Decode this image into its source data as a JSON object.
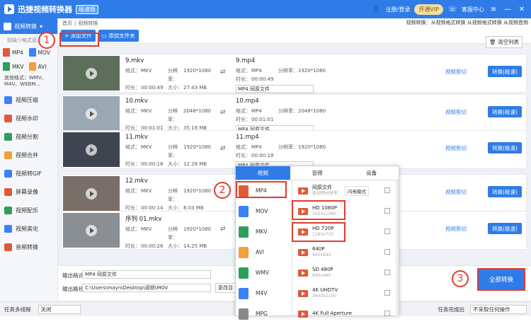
{
  "app": {
    "title": "迅捷视频转换器",
    "badge": "极速版",
    "login": "注册/登录",
    "vip": "开通VIP",
    "service": "客服中心"
  },
  "colors": {
    "primary": "#2f7ce8",
    "annotation": "#e23b2e"
  },
  "sidebar": {
    "active": "视频转换",
    "sub": "较缺少格式说…",
    "formats": [
      {
        "label": "MP4",
        "color": "#e05a3a"
      },
      {
        "label": "MOV",
        "color": "#3b82f6"
      },
      {
        "label": "MKV",
        "color": "#2e9e5b"
      },
      {
        "label": "AVI",
        "color": "#f2a03d"
      }
    ],
    "other": "其他格式：WMV、M4V、WEBM...",
    "items": [
      "视频压缩",
      "视频水印",
      "视频分割",
      "视频合并",
      "视频转GIF",
      "屏幕录像",
      "视频配乐",
      "视频美化",
      "音频转换"
    ]
  },
  "breadcrumb": {
    "home": "首页",
    "sep": "|",
    "current": "视频转换",
    "right": "视频转换：从视频格式转换 从视频格式转换 从视频音频"
  },
  "toolbar": {
    "add_file": "添加文件",
    "add_folder": "添加文件夹",
    "clear": "清空列表"
  },
  "rows": [
    {
      "name": "9.mkv",
      "format": "MKV",
      "res": "1920*1080",
      "dur": "00:00:49",
      "size": "27.43 MB",
      "out": "9.mp4",
      "out_format": "MP4",
      "out_res": "1920*1080",
      "out_dur": "00:00:49",
      "preset": "MP4 同原文件",
      "cut": "视频剪切",
      "conv": "转换(极速)",
      "thumb": "#5d6f5a"
    },
    {
      "name": "10.mkv",
      "format": "MKV",
      "res": "2048*1080",
      "dur": "00:01:01",
      "size": "35.19 MB",
      "out": "10.mp4",
      "out_format": "MP4",
      "out_res": "2048*1080",
      "out_dur": "00:01:01",
      "preset": "MP4 同原文件",
      "cut": "视频剪切",
      "conv": "转换(极速)",
      "thumb": "#9aa8b3"
    },
    {
      "name": "11.mkv",
      "format": "MKV",
      "res": "1920*1080",
      "dur": "00:00:18",
      "size": "12.28 MB",
      "out": "11.mp4",
      "out_format": "MP4",
      "out_res": "1920*1080",
      "out_dur": "00:00:18",
      "preset": "MP4 同原文件",
      "cut": "视频剪切",
      "conv": "转换(极速)",
      "thumb": "#3e4550"
    },
    {
      "name": "12.mkv",
      "format": "MKV",
      "res": "1920*1080",
      "dur": "00:00:14",
      "size": "8.03 MB",
      "cut": "视频剪切",
      "conv": "转换(极速)",
      "thumb": "#7a6e68"
    },
    {
      "name": "序列 01.mkv",
      "format": "MKV",
      "res": "1920*1080",
      "dur": "00:00:26",
      "size": "14.25 MB",
      "cut": "视频剪切",
      "conv": "转换(极速)",
      "thumb": "#8a8f94"
    }
  ],
  "labels": {
    "format": "格式：",
    "res": "分辨率：",
    "dur": "时长：",
    "size": "大小："
  },
  "bottom": {
    "out_format_label": "输出格式:",
    "out_format": "MP4  同原文件",
    "out_path_label": "输出路径:",
    "out_path": "C:\\Users\\mayn\\Desktop\\视频\\MOV",
    "change": "更改目",
    "all": "全部转换"
  },
  "status": {
    "multi": "任务多线程",
    "off": "关闭",
    "done": "任务完成后",
    "none": "不采取任何操作"
  },
  "popup": {
    "tabs": [
      "视频",
      "音频",
      "设备"
    ],
    "formats": [
      {
        "label": "MP4",
        "color": "#e05a3a"
      },
      {
        "label": "MOV",
        "color": "#3b82f6"
      },
      {
        "label": "MKV",
        "color": "#2e9e5b"
      },
      {
        "label": "AVI",
        "color": "#f2a03d"
      },
      {
        "label": "WMV",
        "color": "#2e9e5b"
      },
      {
        "label": "M4V",
        "color": "#3b82f6"
      },
      {
        "label": "MPG",
        "color": "#888"
      }
    ],
    "presets": [
      {
        "t": "同原文件",
        "s": "依视频分辨率",
        "fast": "闪电模式"
      },
      {
        "t": "HD 1080P",
        "s": "1920x1080"
      },
      {
        "t": "HD 720P",
        "s": "1280x720"
      },
      {
        "t": "640P",
        "s": "960x640"
      },
      {
        "t": "SD 480P",
        "s": "640x480"
      },
      {
        "t": "4K UHDTV",
        "s": "3840x2160"
      },
      {
        "t": "4K Full Aperture",
        "s": ""
      }
    ]
  },
  "annotations": [
    "1",
    "2",
    "3"
  ]
}
